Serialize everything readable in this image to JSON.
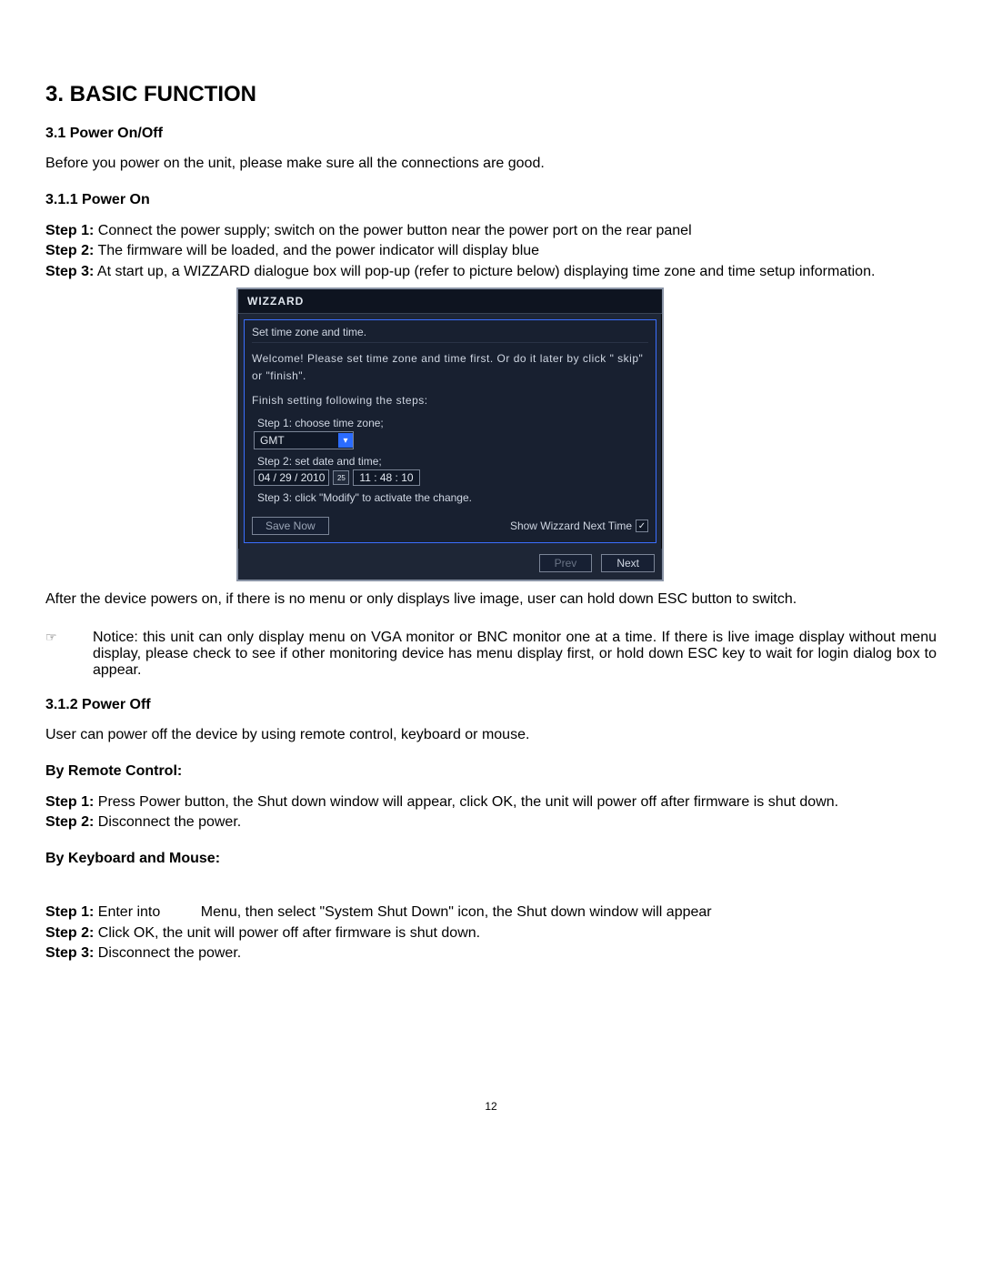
{
  "doc": {
    "h1": "3. BASIC FUNCTION",
    "s1": "3.1 Power On/Off",
    "p1": "Before you power on the unit, please make sure all the connections are good.",
    "s11": "3.1.1 Power On",
    "step_label": {
      "s1": "Step 1:",
      "s2": "Step 2:",
      "s3": "Step 3:"
    },
    "on_step1": " Connect the power supply; switch on the power button near the power port on the rear panel",
    "on_step2": " The firmware will be loaded, and the power indicator will display blue",
    "on_step3": " At start up, a WIZZARD dialogue box will pop-up (refer to picture below) displaying time zone and time setup information.",
    "after": "After the device powers on, if there is no menu or only displays live image, user can hold down ESC button to switch.",
    "notice": "Notice: this unit can only display menu on VGA monitor or BNC monitor one at a time. If there is live image display without menu display, please check to see if other monitoring device has menu display first, or hold down ESC key to wait for login dialog box to appear.",
    "s12": "3.1.2 Power Off",
    "off_intro": "User can power off the device by using remote control, keyboard or mouse.",
    "by_rc": "By Remote Control:",
    "rc_step1": " Press Power button, the Shut down window will appear, click OK, the unit will power off after firmware is shut down.",
    "rc_step2": " Disconnect the power.",
    "by_km": "By Keyboard and Mouse:",
    "km_step1_a": " Enter into",
    "km_step1_b": "Menu, then select \"System Shut Down\" icon, the Shut down window will appear",
    "km_step2": " Click OK, the unit will power off after firmware is shut down.",
    "km_step3": " Disconnect the power.",
    "page_no": "12"
  },
  "wizzard": {
    "title": "WIZZARD",
    "subtitle": "Set time zone and time.",
    "welcome": "Welcome! Please set time zone and time first. Or do it later by click \" skip\" or \"finish\".",
    "follow": "Finish setting following the steps:",
    "step1": "Step 1: choose time zone;",
    "tz_value": "GMT",
    "step2": "Step 2: set date and time;",
    "date_value": "04 / 29 / 2010",
    "time_value": "11 : 48 : 10",
    "step3": "Step 3: click \"Modify\" to activate the change.",
    "save_label": "Save Now",
    "show_next": "Show Wizzard Next Time",
    "prev": "Prev",
    "next": "Next"
  }
}
